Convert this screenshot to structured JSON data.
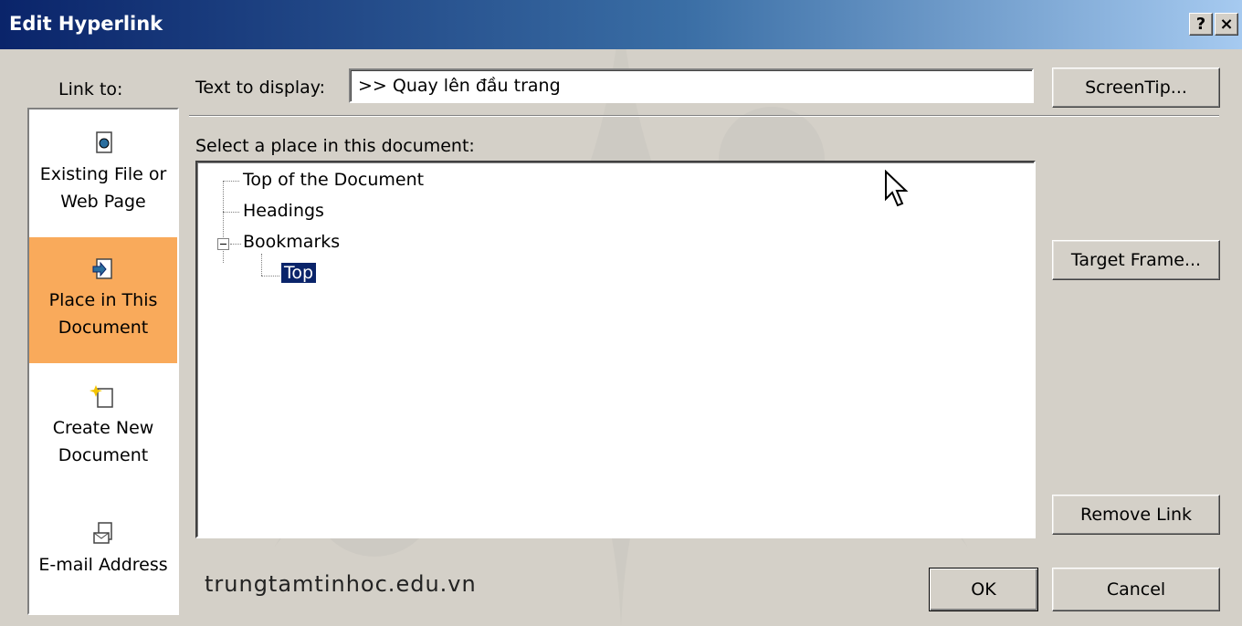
{
  "window": {
    "title": "Edit Hyperlink",
    "help_button": "?",
    "close_button": "×"
  },
  "link_to": {
    "label": "Link to:",
    "items": [
      {
        "line1": "Existing File or",
        "line2": "Web Page",
        "icon": "web-page-icon"
      },
      {
        "line1": "Place in This",
        "line2": "Document",
        "icon": "place-in-document-icon",
        "selected": true
      },
      {
        "line1": "Create New",
        "line2": "Document",
        "icon": "new-document-icon"
      },
      {
        "line1": "E-mail Address",
        "line2": "",
        "icon": "email-icon"
      }
    ]
  },
  "text_to_display": {
    "label": "Text to display:",
    "value": ">> Quay lên đầu trang"
  },
  "place_select": {
    "label": "Select a place in this document:",
    "tree": [
      {
        "label": "Top of the Document"
      },
      {
        "label": "Headings"
      },
      {
        "label": "Bookmarks",
        "expanded": true,
        "children": [
          {
            "label": "Top",
            "selected": true
          }
        ]
      }
    ]
  },
  "buttons": {
    "screentip": "ScreenTip...",
    "target_frame": "Target Frame...",
    "remove_link": "Remove Link",
    "ok": "OK",
    "cancel": "Cancel"
  },
  "watermark_text": "trungtamtinhoc.edu.vn",
  "colors": {
    "selected_link_item": "#f9aa5b",
    "tree_selection": "#0a246a",
    "title_gradient_start": "#0a246a"
  }
}
